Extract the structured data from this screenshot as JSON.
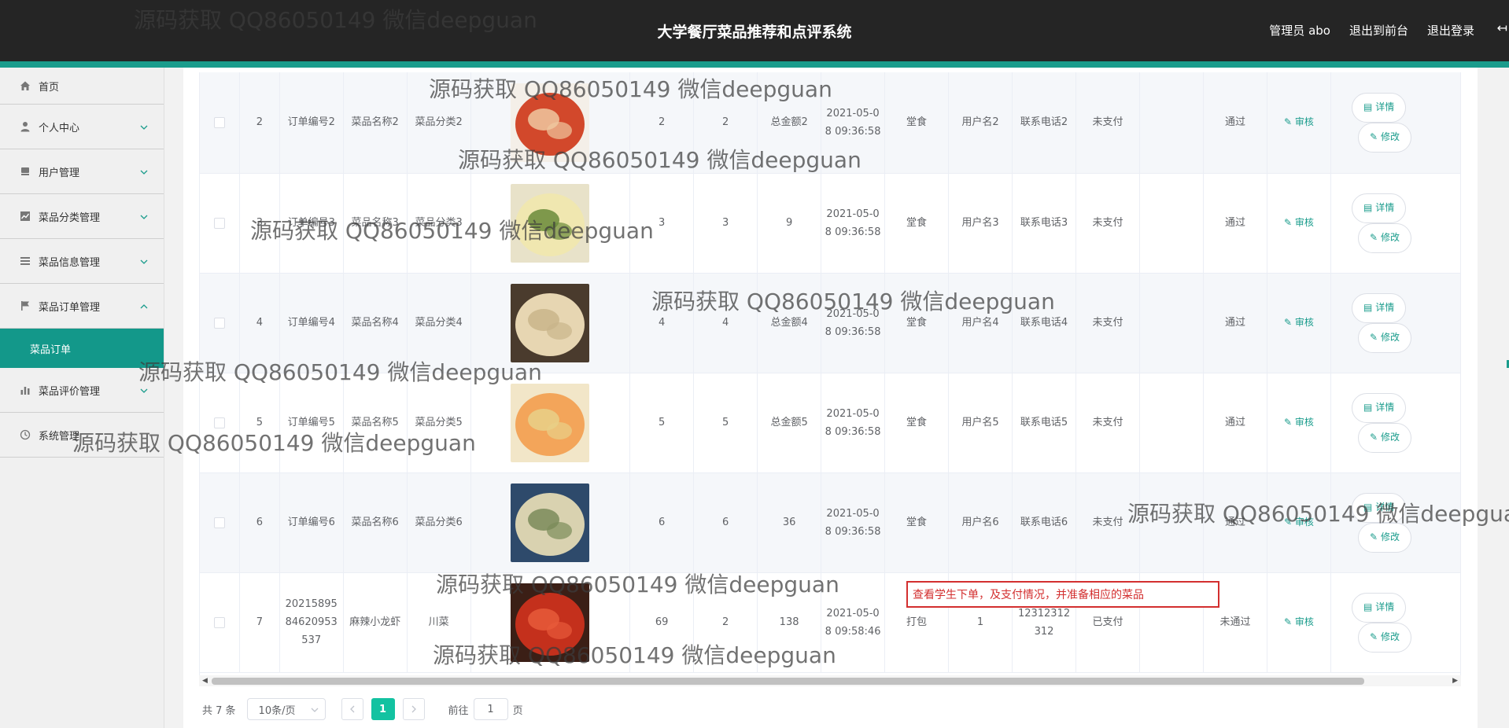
{
  "header": {
    "title": "大学餐厅菜品推荐和点评系统",
    "admin": "管理员 abo",
    "to_front": "退出到前台",
    "logout": "退出登录",
    "collapse_icon": "↤"
  },
  "sidebar": {
    "items": [
      {
        "label": "首页",
        "icon": "home-icon"
      },
      {
        "label": "个人中心",
        "icon": "user-icon"
      },
      {
        "label": "用户管理",
        "icon": "users-icon"
      },
      {
        "label": "菜品分类管理",
        "icon": "chart-icon"
      },
      {
        "label": "菜品信息管理",
        "icon": "list-icon"
      },
      {
        "label": "菜品订单管理",
        "icon": "flag-icon"
      },
      {
        "label": "菜品评价管理",
        "icon": "bar-chart-icon"
      },
      {
        "label": "系统管理",
        "icon": "clock-icon"
      }
    ],
    "sub_active": "菜品订单",
    "accent": "#13988a"
  },
  "table": {
    "rows": [
      {
        "idx": "2",
        "order_no": "订单编号2",
        "dish_name": "菜品名称2",
        "category": "菜品分类2",
        "price": "2",
        "qty": "2",
        "total": "总金额2",
        "time": "2021-05-08 09:36:58",
        "dine": "堂食",
        "user": "用户名2",
        "phone": "联系电话2",
        "pay": "未支付",
        "status": "通过",
        "audit": "审核",
        "detail": "详情",
        "edit": "修改"
      },
      {
        "idx": "3",
        "order_no": "订单编号3",
        "dish_name": "菜品名称3",
        "category": "菜品分类3",
        "price": "3",
        "qty": "3",
        "total": "9",
        "time": "2021-05-08 09:36:58",
        "dine": "堂食",
        "user": "用户名3",
        "phone": "联系电话3",
        "pay": "未支付",
        "status": "通过",
        "audit": "审核",
        "detail": "详情",
        "edit": "修改"
      },
      {
        "idx": "4",
        "order_no": "订单编号4",
        "dish_name": "菜品名称4",
        "category": "菜品分类4",
        "price": "4",
        "qty": "4",
        "total": "总金额4",
        "time": "2021-05-08 09:36:58",
        "dine": "堂食",
        "user": "用户名4",
        "phone": "联系电话4",
        "pay": "未支付",
        "status": "通过",
        "audit": "审核",
        "detail": "详情",
        "edit": "修改"
      },
      {
        "idx": "5",
        "order_no": "订单编号5",
        "dish_name": "菜品名称5",
        "category": "菜品分类5",
        "price": "5",
        "qty": "5",
        "total": "总金额5",
        "time": "2021-05-08 09:36:58",
        "dine": "堂食",
        "user": "用户名5",
        "phone": "联系电话5",
        "pay": "未支付",
        "status": "通过",
        "audit": "审核",
        "detail": "详情",
        "edit": "修改"
      },
      {
        "idx": "6",
        "order_no": "订单编号6",
        "dish_name": "菜品名称6",
        "category": "菜品分类6",
        "price": "6",
        "qty": "6",
        "total": "36",
        "time": "2021-05-08 09:36:58",
        "dine": "堂食",
        "user": "用户名6",
        "phone": "联系电话6",
        "pay": "未支付",
        "status": "通过",
        "audit": "审核",
        "detail": "详情",
        "edit": "修改"
      },
      {
        "idx": "7",
        "order_no": "2021589584620953537",
        "dish_name": "麻辣小龙虾",
        "category": "川菜",
        "price": "69",
        "qty": "2",
        "total": "138",
        "time": "2021-05-08 09:58:46",
        "dine": "打包",
        "user": "1",
        "phone": "12312312312",
        "pay": "已支付",
        "status": "未通过",
        "audit": "审核",
        "detail": "详情",
        "edit": "修改"
      }
    ]
  },
  "pager": {
    "total": "共 7 条",
    "size": "10条/页",
    "current": "1",
    "goto_label": "前往",
    "goto_value": "1",
    "page_suffix": "页"
  },
  "annotation": "查看学生下单，及支付情况，并准备相应的菜品",
  "watermark": "源码获取 QQ86050149 微信deepguan"
}
